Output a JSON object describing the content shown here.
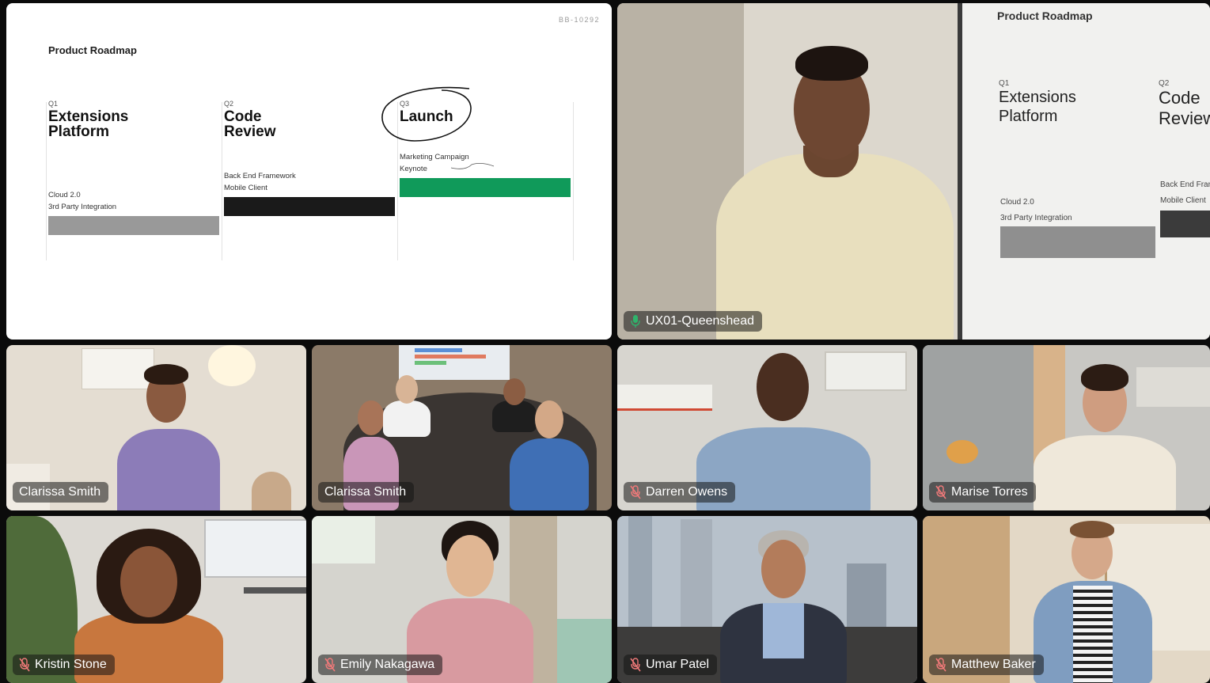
{
  "slide": {
    "id": "BB-10292",
    "title": "Product Roadmap",
    "columns": [
      {
        "quarter": "Q1",
        "title": "Extensions\nPlatform",
        "items": [
          "Cloud 2.0",
          "3rd Party Integration"
        ],
        "bar_color": "#999999"
      },
      {
        "quarter": "Q2",
        "title": "Code\nReview",
        "items": [
          "Back End Framework",
          "Mobile Client"
        ],
        "bar_color": "#1a1a1a"
      },
      {
        "quarter": "Q3",
        "title": "Launch",
        "items": [
          "Marketing Campaign",
          "Keynote"
        ],
        "bar_color": "#109a5a"
      }
    ]
  },
  "presenter": {
    "name": "UX01-Queenshead",
    "mic": "unmuted",
    "board": {
      "title": "Product Roadmap",
      "columns": [
        {
          "quarter": "Q1",
          "title": "Extensions\nPlatform",
          "items": [
            "Cloud 2.0",
            "3rd Party Integration"
          ]
        },
        {
          "quarter": "Q2",
          "title": "Code\nReview",
          "items": [
            "Back End Fran",
            "Mobile Client"
          ]
        }
      ]
    }
  },
  "participants": [
    {
      "name": "Clarissa Smith",
      "mic": "none"
    },
    {
      "name": "Clarissa Smith",
      "mic": "none"
    },
    {
      "name": "Darren Owens",
      "mic": "muted"
    },
    {
      "name": "Marise Torres",
      "mic": "muted"
    },
    {
      "name": "Kristin Stone",
      "mic": "muted"
    },
    {
      "name": "Emily Nakagawa",
      "mic": "muted"
    },
    {
      "name": "Umar Patel",
      "mic": "muted"
    },
    {
      "name": "Matthew Baker",
      "mic": "muted"
    }
  ],
  "colors": {
    "mic_on": "#2fb36b",
    "mic_muted": "#f27a7a",
    "slide_green": "#109a5a"
  }
}
